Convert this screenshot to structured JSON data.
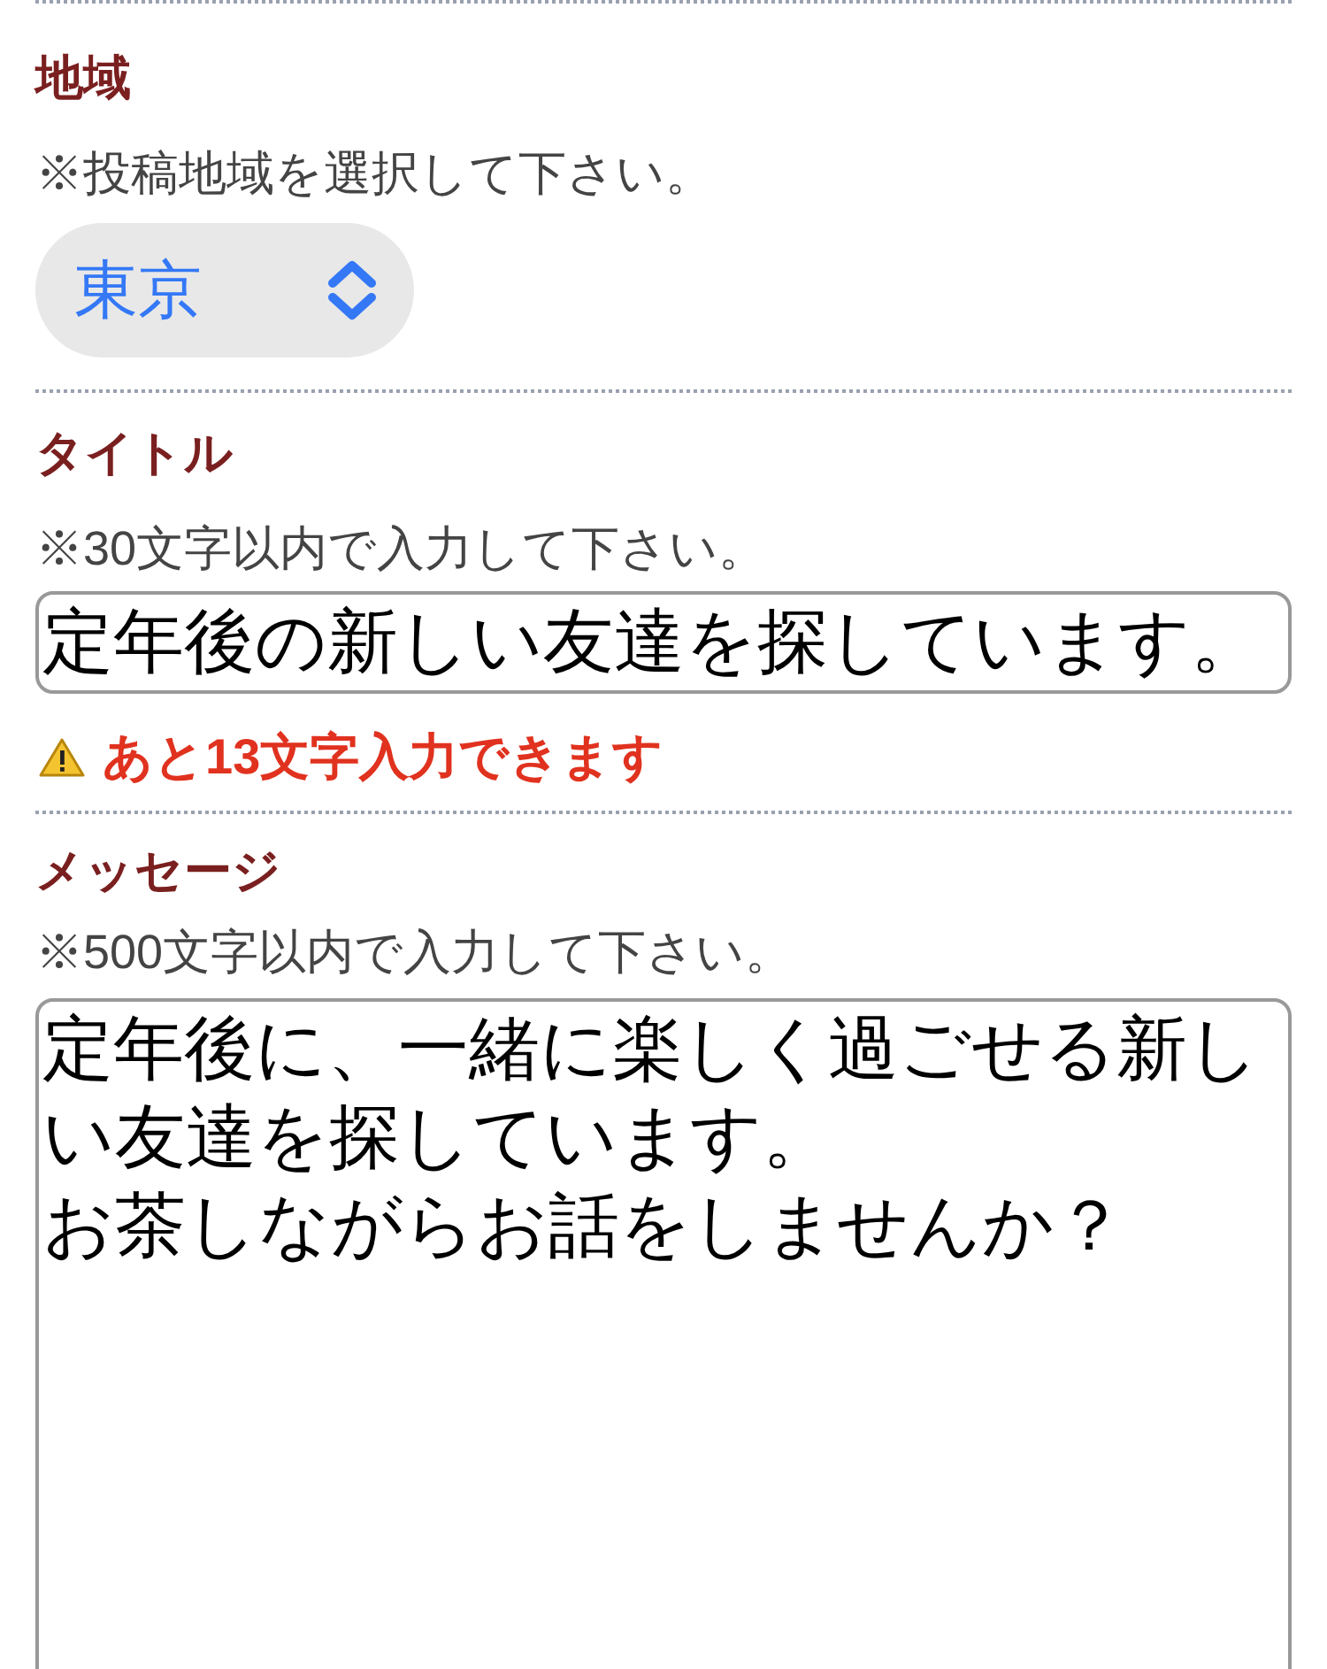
{
  "region": {
    "label": "地域",
    "hint": "※投稿地域を選択して下さい。",
    "value": "東京"
  },
  "title": {
    "label": "タイトル",
    "hint": "※30文字以内で入力して下さい。",
    "value": "定年後の新しい友達を探しています。",
    "warning": "あと13文字入力できます"
  },
  "message": {
    "label": "メッセージ",
    "hint": "※500文字以内で入力して下さい。",
    "paragraphs": [
      "定年後に、一緒に楽しく過ごせる新しい友達を探しています。",
      "お茶しながらお話をしませんか？"
    ]
  }
}
